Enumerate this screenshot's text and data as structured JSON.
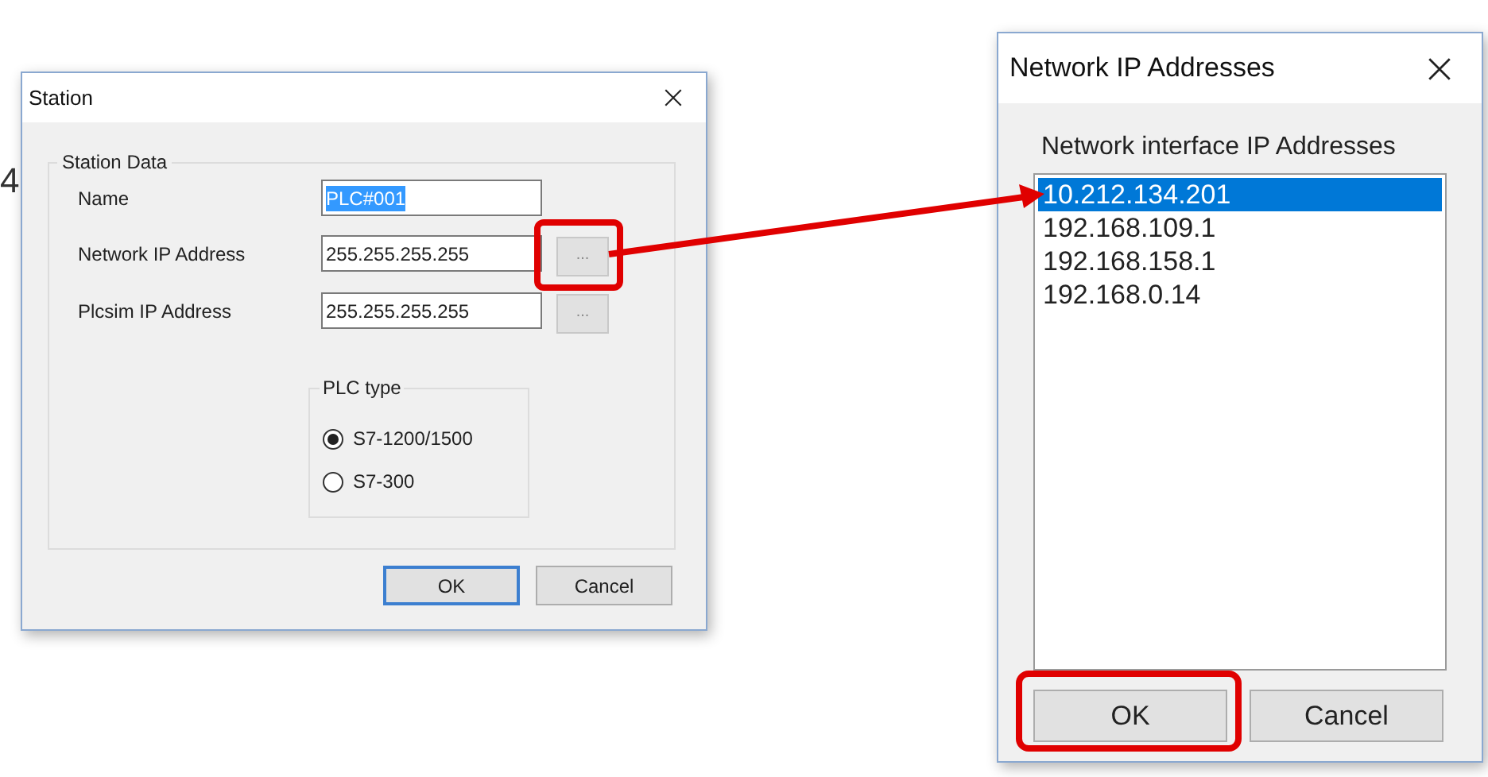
{
  "background_text": "4",
  "station_dialog": {
    "title": "Station",
    "group_title": "Station Data",
    "fields": [
      {
        "label": "Name",
        "value": "PLC#001",
        "text_selected": true
      },
      {
        "label": "Network IP Address",
        "value": "255.255.255.255",
        "text_selected": false,
        "browse_label": "...",
        "highlighted": true
      },
      {
        "label": "Plcsim IP Address",
        "value": "255.255.255.255",
        "text_selected": false,
        "browse_label": "...",
        "highlighted": false
      }
    ],
    "plc_type": {
      "title": "PLC type",
      "options": [
        {
          "label": "S7-1200/1500",
          "selected": true
        },
        {
          "label": "S7-300",
          "selected": false
        }
      ]
    },
    "buttons": [
      {
        "label": "OK",
        "default": true
      },
      {
        "label": "Cancel",
        "default": false
      }
    ]
  },
  "ip_dialog": {
    "title": "Network IP Addresses",
    "list_title": "Network interface IP Addresses",
    "addresses": [
      {
        "text": "10.212.134.201",
        "selected": true
      },
      {
        "text": "192.168.109.1",
        "selected": false
      },
      {
        "text": "192.168.158.1",
        "selected": false
      },
      {
        "text": "192.168.0.14",
        "selected": false
      }
    ],
    "buttons": [
      {
        "label": "OK",
        "highlighted": true
      },
      {
        "label": "Cancel",
        "highlighted": false
      }
    ]
  }
}
